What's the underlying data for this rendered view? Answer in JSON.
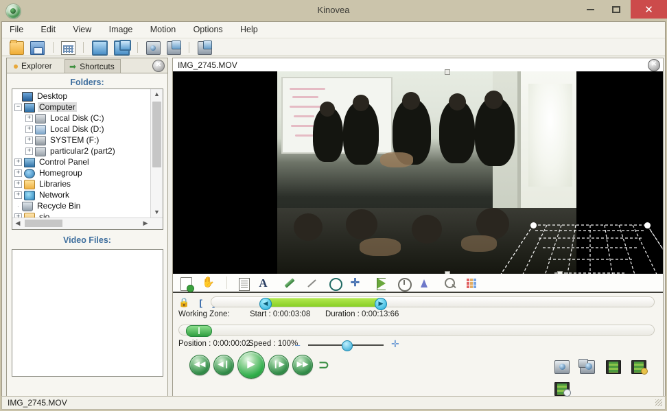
{
  "window": {
    "title": "Kinovea",
    "app_icon": "kinovea-logo-icon",
    "minimize": "minimize-icon",
    "maximize": "maximize-icon",
    "close": "✕",
    "close_color": "#cc4b4b",
    "chrome_color": "#cbc4ab"
  },
  "menu": {
    "items": [
      {
        "label": "File"
      },
      {
        "label": "Edit"
      },
      {
        "label": "View"
      },
      {
        "label": "Image"
      },
      {
        "label": "Motion"
      },
      {
        "label": "Options"
      },
      {
        "label": "Help"
      }
    ]
  },
  "toolbar": {
    "items": [
      {
        "name": "open-folder-icon"
      },
      {
        "name": "save-icon"
      },
      {
        "name": "thumbnails-grid-icon"
      },
      {
        "name": "one-player-screen-icon"
      },
      {
        "name": "two-player-screens-icon"
      },
      {
        "name": "one-capture-screen-icon"
      },
      {
        "name": "two-capture-screens-icon"
      },
      {
        "name": "mixed-screens-icon"
      }
    ]
  },
  "explorer": {
    "tabs": [
      {
        "label": "Explorer",
        "active": true,
        "icon": "bullet-icon"
      },
      {
        "label": "Shortcuts",
        "active": false,
        "icon": "green-arrow-icon"
      }
    ],
    "close_glyph": "✕",
    "folders_title": "Folders:",
    "video_files_title": "Video Files:",
    "tree": [
      {
        "label": "Desktop",
        "depth": 0,
        "expander": "",
        "icon": "desktop-icon",
        "selected": false
      },
      {
        "label": "Computer",
        "depth": 1,
        "expander": "-",
        "icon": "computer-icon",
        "selected": true
      },
      {
        "label": "Local Disk (C:)",
        "depth": 2,
        "expander": "+",
        "icon": "hard-disk-icon",
        "selected": false
      },
      {
        "label": "Local Disk (D:)",
        "depth": 2,
        "expander": "+",
        "icon": "hard-disk-2-icon",
        "selected": false
      },
      {
        "label": "SYSTEM (F:)",
        "depth": 2,
        "expander": "+",
        "icon": "system-drive-icon",
        "selected": false
      },
      {
        "label": "particular2 (part2)",
        "depth": 2,
        "expander": "+",
        "icon": "partition-icon",
        "selected": false
      },
      {
        "label": "Control Panel",
        "depth": 1,
        "expander": "+",
        "icon": "control-panel-icon",
        "selected": false
      },
      {
        "label": "Homegroup",
        "depth": 1,
        "expander": "+",
        "icon": "homegroup-icon",
        "selected": false
      },
      {
        "label": "Libraries",
        "depth": 1,
        "expander": "+",
        "icon": "libraries-icon",
        "selected": false
      },
      {
        "label": "Network",
        "depth": 1,
        "expander": "+",
        "icon": "network-icon",
        "selected": false
      },
      {
        "label": "Recycle Bin",
        "depth": 1,
        "expander": "",
        "icon": "recycle-bin-icon",
        "selected": false
      },
      {
        "label": "sio",
        "depth": 1,
        "expander": "+",
        "icon": "user-folder-icon",
        "selected": false
      }
    ],
    "video_files": []
  },
  "player": {
    "file_name": "IMG_2745.MOV",
    "close_glyph": "✕",
    "tools": [
      {
        "name": "add-keyframe-icon"
      },
      {
        "name": "hand-pan-icon"
      },
      {
        "name": "comment-note-icon"
      },
      {
        "name": "text-tool-icon"
      },
      {
        "name": "pencil-tool-icon"
      },
      {
        "name": "line-tool-icon"
      },
      {
        "name": "circle-tool-icon"
      },
      {
        "name": "crossmark-tool-icon"
      },
      {
        "name": "angle-tool-icon"
      },
      {
        "name": "stopwatch-tool-icon"
      },
      {
        "name": "perspective-grid-tool-icon"
      },
      {
        "name": "magnifier-tool-icon"
      },
      {
        "name": "color-palette-icon"
      }
    ],
    "working_zone": {
      "lock_icon": "padlock-icon",
      "mark_in_label": "[",
      "mark_out_label": "]",
      "reset_label": "|◀",
      "label": "Working Zone:",
      "start": "Start : 0:00:03:08",
      "duration": "Duration : 0:00:13:66"
    },
    "position": {
      "label": "Position : 0:00:00:02",
      "speed_label": "Speed : 100%",
      "minus": "–",
      "plus": "✛"
    },
    "playback": [
      {
        "name": "first-frame-button",
        "glyph": "◀◀"
      },
      {
        "name": "previous-frame-button",
        "glyph": "◀❙"
      },
      {
        "name": "play-button",
        "glyph": "▶"
      },
      {
        "name": "next-frame-button",
        "glyph": "❙▶"
      },
      {
        "name": "last-frame-button",
        "glyph": "▶▶"
      },
      {
        "name": "loop-button",
        "glyph": "⊃"
      }
    ],
    "export": [
      {
        "name": "save-snapshot-icon"
      },
      {
        "name": "save-composite-snapshot-icon"
      },
      {
        "name": "save-video-icon"
      },
      {
        "name": "save-video-with-keyimages-icon"
      },
      {
        "name": "save-slow-video-icon"
      }
    ]
  },
  "statusbar": {
    "text": "IMG_2745.MOV"
  },
  "colors": {
    "accent_blue": "#3f6f9e",
    "zone_green": "#88cf24",
    "play_green": "#2fae4a",
    "close_red": "#cc4b4b"
  }
}
